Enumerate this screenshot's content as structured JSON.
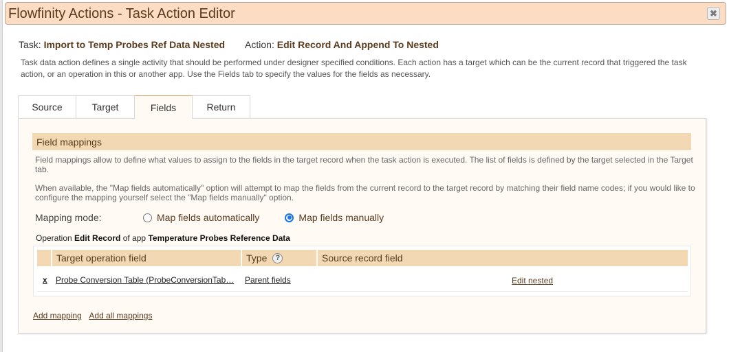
{
  "window": {
    "title": "Flowfinity Actions - Task Action Editor",
    "close_icon": "close-icon"
  },
  "header": {
    "task_label": "Task:",
    "task_value": "Import to Temp Probes Ref Data Nested",
    "action_label": "Action:",
    "action_value": "Edit Record And Append To Nested",
    "description": "Task data action defines a single activity that should be performed under designer specified conditions. Each action has a target which can be the current record that triggered the task action, or an operation in this or another app. Use the Fields tab to specify the values for the fields as necessary."
  },
  "tabs": [
    {
      "label": "Source",
      "active": false
    },
    {
      "label": "Target",
      "active": false
    },
    {
      "label": "Fields",
      "active": true
    },
    {
      "label": "Return",
      "active": false
    }
  ],
  "fields_panel": {
    "section_title": "Field mappings",
    "help_1": "Field mappings allow to define what values to assign to the fields in the target record when the task action is executed. The list of fields is defined by the target selected in the Target tab.",
    "help_2": "When available, the \"Map fields automatically\" option will attempt to map the fields from the current record to the target record by matching their field name codes; if you would like to configure the mapping yourself select the \"Map fields manually\" option.",
    "mapping_mode_label": "Mapping mode:",
    "mapping_options": [
      {
        "label": "Map fields automatically",
        "checked": false
      },
      {
        "label": "Map fields manually",
        "checked": true
      }
    ],
    "operation": {
      "prefix": "Operation",
      "operation_name": "Edit Record",
      "middle": "of app",
      "app_name": "Temperature Probes Reference Data"
    },
    "grid": {
      "columns": [
        "Target operation field",
        "Type",
        "Source record field"
      ],
      "type_help_icon": "question-icon",
      "rows": [
        {
          "delete_label": "x",
          "target_field": "Probe Conversion Table (ProbeConversionTab…",
          "type": "Parent fields",
          "source_action": "Edit nested"
        }
      ]
    },
    "add_mapping": "Add mapping",
    "add_all_mappings": "Add all mappings"
  }
}
